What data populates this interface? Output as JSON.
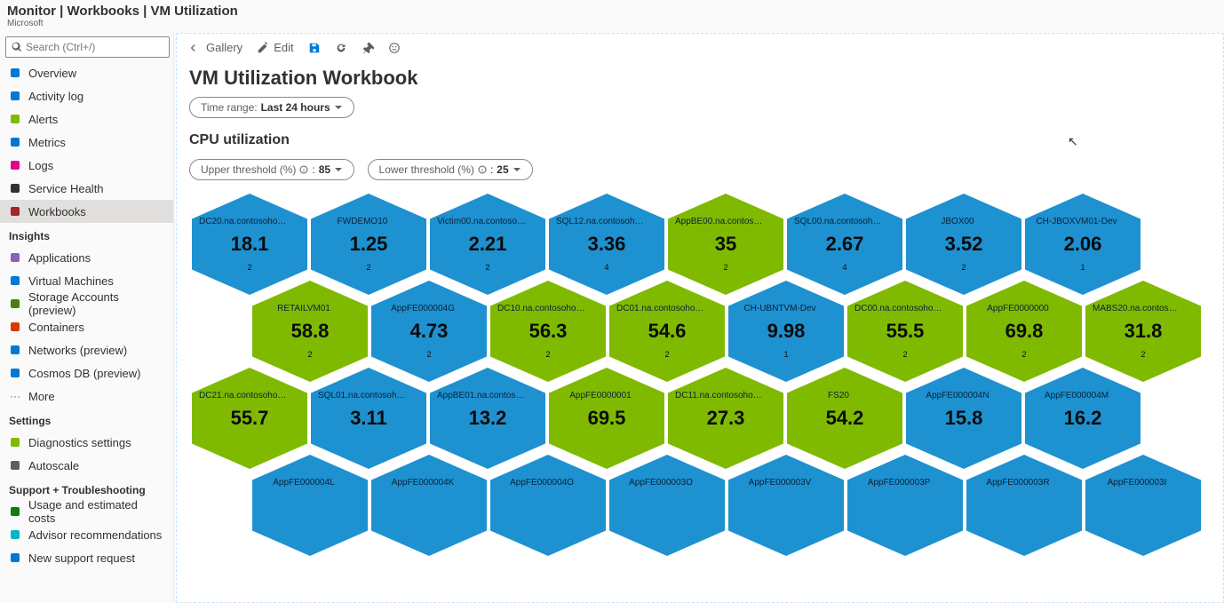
{
  "header": {
    "title": "Monitor | Workbooks | VM Utilization",
    "subtitle": "Microsoft"
  },
  "search": {
    "placeholder": "Search (Ctrl+/)"
  },
  "sidebar": {
    "main": [
      {
        "icon": "overview-icon",
        "label": "Overview",
        "color": "#0078d4"
      },
      {
        "icon": "activity-log-icon",
        "label": "Activity log",
        "color": "#0078d4"
      },
      {
        "icon": "alerts-icon",
        "label": "Alerts",
        "color": "#7fba00"
      },
      {
        "icon": "metrics-icon",
        "label": "Metrics",
        "color": "#0078d4"
      },
      {
        "icon": "logs-icon",
        "label": "Logs",
        "color": "#e3008c"
      },
      {
        "icon": "service-health-icon",
        "label": "Service Health",
        "color": "#323130"
      },
      {
        "icon": "workbooks-icon",
        "label": "Workbooks",
        "color": "#a4262c",
        "selected": true
      }
    ],
    "insights_header": "Insights",
    "insights": [
      {
        "icon": "applications-icon",
        "label": "Applications",
        "color": "#8764b8"
      },
      {
        "icon": "vm-icon",
        "label": "Virtual Machines",
        "color": "#0078d4"
      },
      {
        "icon": "storage-icon",
        "label": "Storage Accounts (preview)",
        "color": "#498205"
      },
      {
        "icon": "containers-icon",
        "label": "Containers",
        "color": "#d83b01"
      },
      {
        "icon": "networks-icon",
        "label": "Networks (preview)",
        "color": "#0078d4"
      },
      {
        "icon": "cosmos-icon",
        "label": "Cosmos DB (preview)",
        "color": "#0078d4"
      },
      {
        "icon": "more-icon",
        "label": "More",
        "color": "#605e5c"
      }
    ],
    "settings_header": "Settings",
    "settings": [
      {
        "icon": "diag-icon",
        "label": "Diagnostics settings",
        "color": "#7fba00"
      },
      {
        "icon": "autoscale-icon",
        "label": "Autoscale",
        "color": "#605e5c"
      }
    ],
    "support_header": "Support + Troubleshooting",
    "support": [
      {
        "icon": "usage-icon",
        "label": "Usage and estimated costs",
        "color": "#107c10"
      },
      {
        "icon": "advisor-icon",
        "label": "Advisor recommendations",
        "color": "#00b7c3"
      },
      {
        "icon": "support-req-icon",
        "label": "New support request",
        "color": "#0078d4"
      }
    ]
  },
  "toolbar": {
    "gallery": "Gallery",
    "edit": "Edit"
  },
  "page": {
    "title": "VM Utilization Workbook",
    "time_range_label": "Time range:",
    "time_range_value": "Last 24 hours",
    "cpu_header": "CPU utilization",
    "upper_label": "Upper threshold (%)",
    "upper_value": "85",
    "lower_label": "Lower threshold (%)",
    "lower_value": "25"
  },
  "hex": {
    "rows": [
      [
        "DC20.na.contosohot…",
        "FWDEMO10",
        "Victim00.na.contoso…",
        "SQL12.na.contosohot…",
        "AppBE00.na.contoso…",
        "SQL00.na.contosohot…",
        "JBOX00",
        "CH-JBOXVM01-Dev"
      ],
      [
        "RETAILVM01",
        "AppFE000004G",
        "DC10.na.contosohot…",
        "DC01.na.contosohot…",
        "CH-UBNTVM-Dev",
        "DC00.na.contosohot…",
        "AppFE0000000",
        "MABS20.na.contoso…"
      ],
      [
        "DC21.na.contosohot…",
        "SQL01.na.contosohot…",
        "AppBE01.na.contoso…",
        "AppFE0000001",
        "DC11.na.contosohot…",
        "FS20",
        "AppFE000004N",
        "AppFE000004M"
      ],
      [
        "AppFE000004L",
        "AppFE000004K",
        "AppFE000004O",
        "AppFE000003O",
        "AppFE000003V",
        "AppFE000003P",
        "AppFE000003R",
        "AppFE000003I"
      ]
    ],
    "vals": [
      [
        "18.1",
        "1.25",
        "2.21",
        "3.36",
        "35",
        "2.67",
        "3.52",
        "2.06"
      ],
      [
        "58.8",
        "4.73",
        "56.3",
        "54.6",
        "9.98",
        "55.5",
        "69.8",
        "31.8"
      ],
      [
        "55.7",
        "3.11",
        "13.2",
        "69.5",
        "27.3",
        "54.2",
        "15.8",
        "16.2"
      ],
      [
        "",
        "",
        "",
        "",
        "",
        "",
        "",
        ""
      ]
    ],
    "subs": [
      [
        "2",
        "2",
        "2",
        "4",
        "2",
        "4",
        "2",
        "1"
      ],
      [
        "2",
        "2",
        "2",
        "2",
        "1",
        "2",
        "2",
        "2"
      ],
      [
        "",
        "",
        "",
        "",
        "",
        "",
        "",
        ""
      ],
      [
        "",
        "",
        "",
        "",
        "",
        "",
        "",
        ""
      ]
    ],
    "colors": [
      [
        "b",
        "b",
        "b",
        "b",
        "g",
        "b",
        "b",
        "b"
      ],
      [
        "g",
        "b",
        "g",
        "g",
        "b",
        "g",
        "g",
        "g"
      ],
      [
        "g",
        "b",
        "b",
        "g",
        "g",
        "g",
        "b",
        "b"
      ],
      [
        "b",
        "b",
        "b",
        "b",
        "b",
        "b",
        "b",
        "b"
      ]
    ]
  }
}
